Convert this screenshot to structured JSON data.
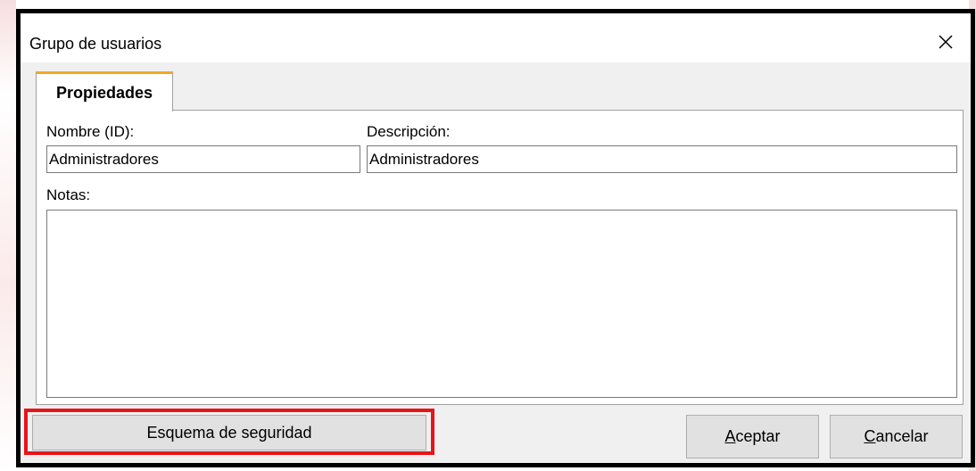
{
  "dialog": {
    "title": "Grupo de usuarios",
    "close_glyph": "✕"
  },
  "tabs": [
    {
      "label": "Propiedades",
      "active": true
    }
  ],
  "form": {
    "nombre_label": "Nombre (ID):",
    "nombre_value": "Administradores",
    "descripcion_label": "Descripción:",
    "descripcion_value": "Administradores",
    "notas_label": "Notas:",
    "notas_value": ""
  },
  "buttons": {
    "security_scheme": "Esquema de seguridad",
    "accept_mnemonic": "A",
    "accept_rest": "ceptar",
    "cancel_mnemonic": "C",
    "cancel_rest": "ancelar"
  },
  "colors": {
    "tab_accent": "#f5a623",
    "highlight": "#e8141b"
  },
  "icons": {
    "close": "close-icon"
  }
}
